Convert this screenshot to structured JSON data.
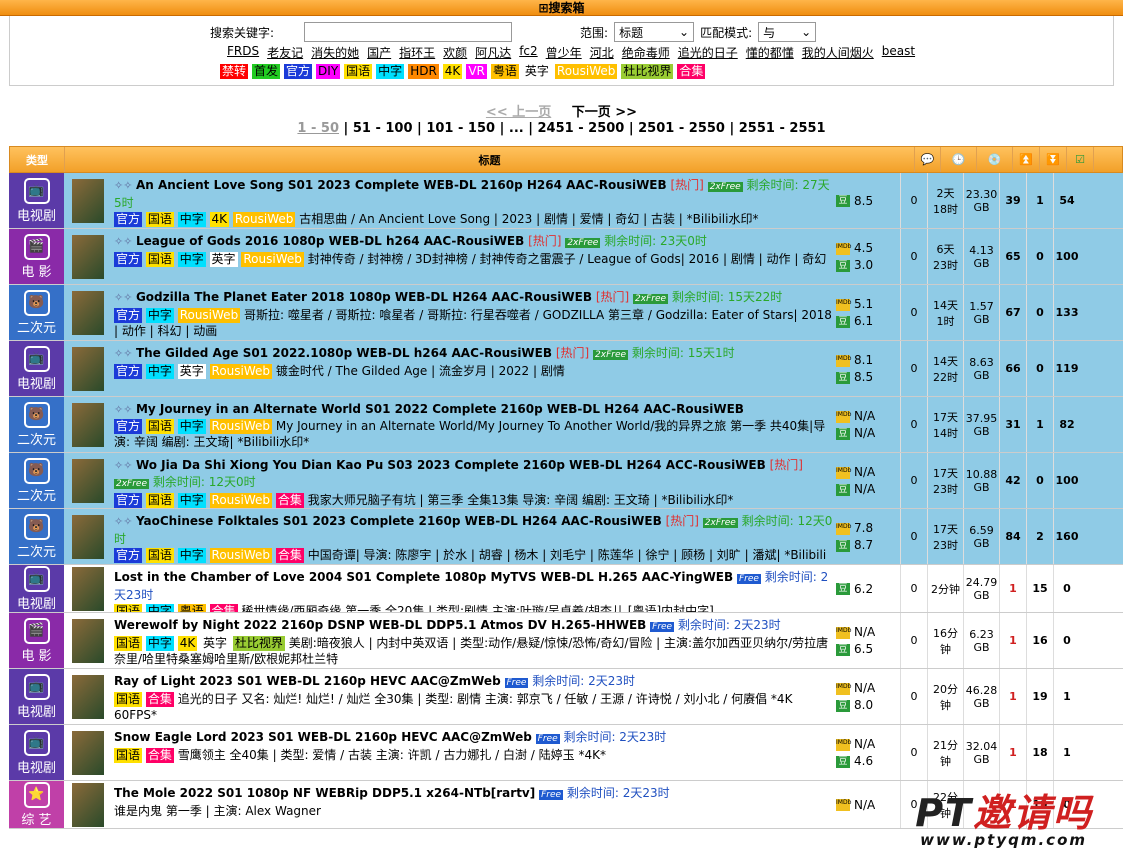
{
  "toggle": "搜索箱",
  "search": {
    "keyword_label": "搜索关键字:",
    "keyword_value": "",
    "range_label": "范围:",
    "range_value": "标题",
    "mode_label": "匹配模式:",
    "mode_value": "与",
    "hot_words": [
      "FRDS",
      "老友记",
      "消失的她",
      "国产",
      "指环王",
      "欢颜",
      "阿凡达",
      "fc2",
      "曾少年",
      "河北",
      "绝命毒师",
      "追光的日子",
      "懂的都懂",
      "我的人间烟火",
      "beast"
    ],
    "tags": [
      {
        "label": "禁转",
        "color": "#ff0000",
        "fg": "#ffffff"
      },
      {
        "label": "首发",
        "color": "#22cc22",
        "fg": "#000000"
      },
      {
        "label": "官方",
        "color": "#1b3bd8",
        "fg": "#ffffff"
      },
      {
        "label": "DIY",
        "color": "#ff00ff",
        "fg": "#000000"
      },
      {
        "label": "国语",
        "color": "#ffe000",
        "fg": "#000000"
      },
      {
        "label": "中字",
        "color": "#00e0ff",
        "fg": "#000000"
      },
      {
        "label": "HDR",
        "color": "#ff8800",
        "fg": "#000000"
      },
      {
        "label": "4K",
        "color": "#ffe000",
        "fg": "#000000"
      },
      {
        "label": "VR",
        "color": "#ff00ff",
        "fg": "#ffffff"
      },
      {
        "label": "粤语",
        "color": "#ffc000",
        "fg": "#000000"
      },
      {
        "label": "英字",
        "color": "#ffffff",
        "fg": "#000000"
      },
      {
        "label": "RousiWeb",
        "color": "#ffc000",
        "fg": "#ffffff"
      },
      {
        "label": "杜比视界",
        "color": "#99cc33",
        "fg": "#000000"
      },
      {
        "label": "合集",
        "color": "#ff0066",
        "fg": "#ffffff"
      }
    ]
  },
  "pager": {
    "prev": "<< 上一页",
    "next": "下一页 >>",
    "pages": [
      "1 - 50",
      "51 - 100",
      "101 - 150",
      "...",
      "2451 - 2500",
      "2501 - 2550",
      "2551 - 2551"
    ]
  },
  "table": {
    "col_type": "类型",
    "col_title": "标题",
    "rows": [
      {
        "cat": "电视剧",
        "cls": "tv",
        "ico": "📺",
        "hl": true,
        "title": "An Ancient Love Song S01 2023 Complete WEB-DL 2160p H264 AAC-RousiWEB",
        "hot": "[热门]",
        "free": "2xFree",
        "free_cls": "",
        "remain": "剩余时间: 27天5时",
        "remain_cls": "remain-g",
        "tags": [
          "官方",
          "国语",
          "中字",
          "4K",
          "RousiWeb"
        ],
        "sub": "古相思曲 / An Ancient Love Song | 2023 | 剧情 | 爱情 | 奇幻 | 古装 | *Bilibili水印*",
        "imdb": "",
        "douban": "8.5",
        "comments": "0",
        "time": "2天\n18时",
        "size": "23.30\nGB",
        "seed": "39",
        "leech": "1",
        "done": "54",
        "seed_red": false
      },
      {
        "cat": "电 影",
        "cls": "movie",
        "ico": "🎬",
        "hl": true,
        "title": "League of Gods 2016 1080p WEB-DL h264 AAC-RousiWEB",
        "hot": "[热门]",
        "free": "2xFree",
        "free_cls": "",
        "remain": "剩余时间: 23天0时",
        "remain_cls": "remain-g",
        "tags": [
          "官方",
          "国语",
          "中字",
          "英字",
          "RousiWeb"
        ],
        "sub": "封神传奇 / 封神榜 / 3D封神榜 / 封神传奇之雷震子 / League of Gods| 2016 | 剧情 | 动作 | 奇幻",
        "imdb": "4.5",
        "douban": "3.0",
        "comments": "0",
        "time": "6天\n23时",
        "size": "4.13\nGB",
        "seed": "65",
        "leech": "0",
        "done": "100",
        "seed_red": false
      },
      {
        "cat": "二次元",
        "cls": "anime",
        "ico": "🐻",
        "hl": true,
        "title": "Godzilla The Planet Eater 2018 1080p WEB-DL H264 AAC-RousiWEB",
        "hot": "[热门]",
        "free": "2xFree",
        "free_cls": "",
        "remain": "剩余时间: 15天22时",
        "remain_cls": "remain-g",
        "tags": [
          "官方",
          "中字",
          "RousiWeb"
        ],
        "sub": "哥斯拉: 噬星者 / 哥斯拉: 喰星者 / 哥斯拉: 行星吞噬者 / GODZILLA 第三章 / Godzilla: Eater of Stars| 2018 | 动作 | 科幻 | 动画",
        "imdb": "5.1",
        "douban": "6.1",
        "comments": "0",
        "time": "14天\n1时",
        "size": "1.57\nGB",
        "seed": "67",
        "leech": "0",
        "done": "133",
        "seed_red": false
      },
      {
        "cat": "电视剧",
        "cls": "tv",
        "ico": "📺",
        "hl": true,
        "title": "The Gilded Age S01 2022.1080p WEB-DL h264 AAC-RousiWEB",
        "hot": "[热门]",
        "free": "2xFree",
        "free_cls": "",
        "remain": "剩余时间: 15天1时",
        "remain_cls": "remain-g",
        "tags": [
          "官方",
          "中字",
          "英字",
          "RousiWeb"
        ],
        "sub": "镀金时代 / The Gilded Age | 流金岁月 | 2022 | 剧情",
        "imdb": "8.1",
        "douban": "8.5",
        "comments": "0",
        "time": "14天\n22时",
        "size": "8.63\nGB",
        "seed": "66",
        "leech": "0",
        "done": "119",
        "seed_red": false
      },
      {
        "cat": "二次元",
        "cls": "anime",
        "ico": "🐻",
        "hl": true,
        "title": "My Journey in an Alternate World S01 2022 Complete 2160p WEB-DL H264 AAC-RousiWEB",
        "hot": "",
        "free": "",
        "free_cls": "",
        "remain": "",
        "remain_cls": "",
        "tags": [
          "官方",
          "国语",
          "中字",
          "RousiWeb"
        ],
        "sub": "My Journey in an Alternate World/My Journey To Another World/我的异界之旅 第一季 共40集|导演: 辛阔 编剧: 王文琦| *Bilibili水印*",
        "imdb": "N/A",
        "douban": "N/A",
        "comments": "0",
        "time": "17天\n14时",
        "size": "37.95\nGB",
        "seed": "31",
        "leech": "1",
        "done": "82",
        "seed_red": false
      },
      {
        "cat": "二次元",
        "cls": "anime",
        "ico": "🐻",
        "hl": true,
        "title": "Wo Jia Da Shi Xiong You Dian Kao Pu S03 2023 Complete 2160p WEB-DL H264 ACC-RousiWEB",
        "hot": "[热门]",
        "free": "2xFree",
        "free_cls": "",
        "remain": "剩余时间: 12天0时",
        "remain_cls": "remain-g",
        "tags": [
          "官方",
          "国语",
          "中字",
          "RousiWeb",
          "合集"
        ],
        "sub": "我家大师兄脑子有坑 | 第三季 全集13集 导演: 辛阔 编剧: 王文琦 | *Bilibili水印*",
        "imdb": "N/A",
        "douban": "N/A",
        "comments": "0",
        "time": "17天\n23时",
        "size": "10.88\nGB",
        "seed": "42",
        "leech": "0",
        "done": "100",
        "seed_red": false
      },
      {
        "cat": "二次元",
        "cls": "anime",
        "ico": "🐻",
        "hl": true,
        "title": "YaoChinese Folktales S01 2023 Complete 2160p WEB-DL H264 AAC-RousiWEB",
        "hot": "[热门]",
        "free": "2xFree",
        "free_cls": "",
        "remain": "剩余时间: 12天0时",
        "remain_cls": "remain-g",
        "tags": [
          "官方",
          "国语",
          "中字",
          "RousiWeb",
          "合集"
        ],
        "sub": "中国奇谭| 导演: 陈廖宇 | 於水 | 胡睿 | 杨木 | 刘毛宁 | 陈莲华 | 徐宁 | 顾杨 | 刘旷 | 潘斌| *Bilibili水印*",
        "imdb": "7.8",
        "douban": "8.7",
        "comments": "0",
        "time": "17天\n23时",
        "size": "6.59\nGB",
        "seed": "84",
        "leech": "2",
        "done": "160",
        "seed_red": false
      },
      {
        "cat": "电视剧",
        "cls": "tv",
        "ico": "📺",
        "hl": false,
        "title": "Lost in the Chamber of Love 2004 S01 Complete 1080p MyTVS WEB-DL H.265 AAC-YingWEB",
        "hot": "",
        "free": "Free",
        "free_cls": "blue",
        "remain": "剩余时间: 2天23时",
        "remain_cls": "remain-b",
        "tags": [
          "国语",
          "中字",
          "粤语",
          "合集"
        ],
        "sub": "稀世情缘/西厢奇缘 第一季 全20集 | 类型:剧情 主演:叶璇/吴卓羲/胡杏儿 [粤语]内封中字]",
        "imdb": "",
        "douban": "6.2",
        "comments": "0",
        "time": "2分钟",
        "size": "24.79\nGB",
        "seed": "1",
        "leech": "15",
        "done": "0",
        "seed_red": true
      },
      {
        "cat": "电 影",
        "cls": "movie",
        "ico": "🎬",
        "hl": false,
        "title": "Werewolf by Night 2022 2160p DSNP WEB-DL DDP5.1 Atmos DV H.265-HHWEB",
        "hot": "",
        "free": "Free",
        "free_cls": "blue",
        "remain": "剩余时间: 2天23时",
        "remain_cls": "remain-b",
        "tags": [
          "国语",
          "中字",
          "4K",
          "英字",
          "杜比视界"
        ],
        "sub": "美剧:暗夜狼人 | 内封中英双语 | 类型:动作/悬疑/惊悚/恐怖/奇幻/冒险 | 主演:盖尔加西亚贝纳尔/劳拉唐奈里/哈里特桑塞姆哈里斯/欧根妮邦杜兰特",
        "imdb": "N/A",
        "douban": "6.5",
        "comments": "0",
        "time": "16分钟",
        "size": "6.23\nGB",
        "seed": "1",
        "leech": "16",
        "done": "0",
        "seed_red": true
      },
      {
        "cat": "电视剧",
        "cls": "tv",
        "ico": "📺",
        "hl": false,
        "title": "Ray of Light 2023 S01 WEB-DL 2160p HEVC AAC@ZmWeb",
        "hot": "",
        "free": "Free",
        "free_cls": "blue",
        "remain": "剩余时间: 2天23时",
        "remain_cls": "remain-b",
        "tags": [
          "国语",
          "合集"
        ],
        "sub": "追光的日子 又名: 灿烂! 灿烂! / 灿烂 全30集 | 类型: 剧情 主演: 郭京飞 / 任敏 / 王源 / 许诗悦 / 刘小北 / 何赓倡 *4K 60FPS*",
        "imdb": "N/A",
        "douban": "8.0",
        "comments": "0",
        "time": "20分钟",
        "size": "46.28\nGB",
        "seed": "1",
        "leech": "19",
        "done": "1",
        "seed_red": true
      },
      {
        "cat": "电视剧",
        "cls": "tv",
        "ico": "📺",
        "hl": false,
        "title": "Snow Eagle Lord 2023 S01 WEB-DL 2160p HEVC AAC@ZmWeb",
        "hot": "",
        "free": "Free",
        "free_cls": "blue",
        "remain": "剩余时间: 2天23时",
        "remain_cls": "remain-b",
        "tags": [
          "国语",
          "合集"
        ],
        "sub": "雪鹰领主 全40集 | 类型: 爱情 / 古装 主演: 许凯 / 古力娜扎 / 白澍 / 陆婷玉 *4K*",
        "imdb": "N/A",
        "douban": "4.6",
        "comments": "0",
        "time": "21分钟",
        "size": "32.04\nGB",
        "seed": "1",
        "leech": "18",
        "done": "1",
        "seed_red": true
      },
      {
        "cat": "综 艺",
        "cls": "variety",
        "ico": "⭐",
        "hl": false,
        "title": "The Mole 2022 S01 1080p NF WEBRip DDP5.1 x264-NTb[rartv]",
        "hot": "",
        "free": "Free",
        "free_cls": "blue",
        "remain": "剩余时间: 2天23时",
        "remain_cls": "remain-b",
        "tags": [],
        "sub": "谁是内鬼 第一季 | 主演: Alex Wagner",
        "imdb": "N/A",
        "douban": "",
        "comments": "0",
        "time": "22分钟",
        "size": "",
        "seed": "1",
        "leech": "19",
        "done": "0",
        "seed_red": true
      }
    ]
  },
  "watermark": {
    "text_a": "PT",
    "text_b": "邀请吗",
    "url": "www.ptyqm.com"
  }
}
